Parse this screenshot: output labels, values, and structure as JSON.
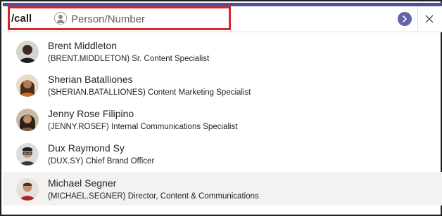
{
  "search_bar": {
    "command": "/call",
    "placeholder": "Person/Number",
    "value": ""
  },
  "colors": {
    "accent": "#6264a7",
    "top_strip": "#4b4f9c",
    "highlight": "#d9252a",
    "selected_row": "#f3f2f1"
  },
  "icons": {
    "field_icon": "person-icon",
    "send": "chevron-right-icon",
    "close": "close-icon"
  },
  "results": [
    {
      "name": "Brent Middleton",
      "handle": "(BRENT.MIDDLETON)",
      "title": "Sr. Content Specialist",
      "selected": false
    },
    {
      "name": "Sherian Batalliones",
      "handle": "(SHERIAN.BATALLIONES)",
      "title": "Content Marketing Specialist",
      "selected": false
    },
    {
      "name": "Jenny Rose Filipino",
      "handle": "(JENNY.ROSEF)",
      "title": "Internal Communications Specialist",
      "selected": false
    },
    {
      "name": "Dux Raymond Sy",
      "handle": "(DUX.SY)",
      "title": "Chief Brand Officer",
      "selected": false
    },
    {
      "name": "Michael Segner",
      "handle": "(MICHAEL.SEGNER)",
      "title": "Director, Content & Communications",
      "selected": true
    }
  ]
}
